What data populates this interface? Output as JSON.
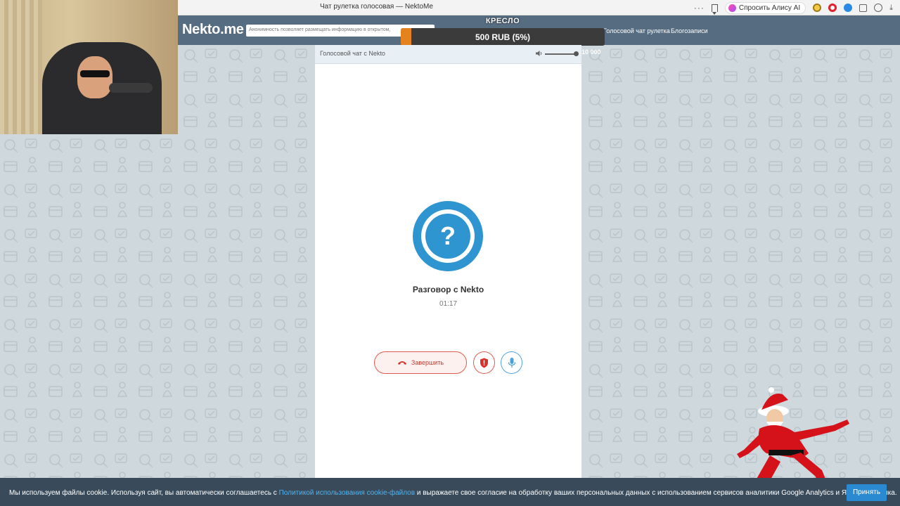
{
  "browser": {
    "tab_title": "Чат рулетка голосовая — NektoMe",
    "menu_label": "···",
    "alice_label": "Спросить Алису AI"
  },
  "site": {
    "logo": "Nekto.me",
    "notice": "Анонимность позволяет размещать информацию в открытом,",
    "nav_voice": "Голосовой чат рулетка",
    "nav_blog": "Блогозаписи"
  },
  "stream": {
    "donation_title": "КРЕСЛО",
    "donation_amount": "500 RUB (5%)",
    "donation_progress": 0.05,
    "donation_min": "0",
    "donation_max": "10 000"
  },
  "chat": {
    "panel_title": "Голосовой чат с Nekto",
    "volume_level": 1.0,
    "avatar_glyph": "?",
    "conversation_title": "Разговор с Nekto",
    "timer": "01:17",
    "end_label": "Завершить"
  },
  "cookie": {
    "text_before": "Мы используем файлы cookie. Используя сайт, вы автоматически соглашаетесь с ",
    "link_text": "Политикой использования cookie-файлов",
    "text_after": " и выражаете свое согласие на обработку ваших персональных данных с использованием сервисов аналитики Google Analytics и Яндекс Метрика.",
    "accept_label": "Принять"
  },
  "colors": {
    "header": "#566c81",
    "accent_blue": "#2f95d1",
    "end_red": "#e05a4f",
    "cookie_bg": "#394b5b",
    "donation_fill": "#e6821e"
  }
}
